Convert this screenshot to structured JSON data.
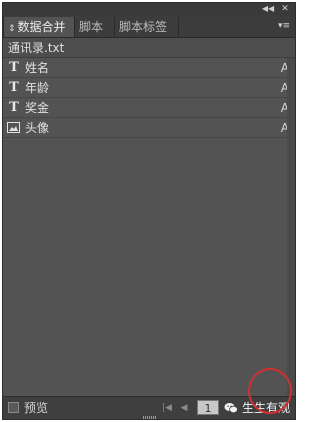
{
  "panel": {
    "titlebar": {
      "collapse_icon": "double-left-arrow",
      "close_icon": "close"
    },
    "tabs": [
      {
        "label": "数据合并",
        "active": true
      },
      {
        "label": "脚本",
        "active": false
      },
      {
        "label": "脚本标签",
        "active": false
      }
    ],
    "tab_menu_icon": "panel-menu",
    "file_name": "通讯录.txt",
    "fields": [
      {
        "icon": "text-field-icon",
        "label": "姓名",
        "align": "A"
      },
      {
        "icon": "text-field-icon",
        "label": "年龄",
        "align": "A"
      },
      {
        "icon": "text-field-icon",
        "label": "奖金",
        "align": "A"
      },
      {
        "icon": "image-field-icon",
        "label": "头像",
        "align": "A"
      }
    ],
    "bottom": {
      "preview_label": "预览",
      "preview_checked": false,
      "page_number": "1",
      "watermark_text": "生生有观"
    }
  },
  "colors": {
    "panel_bg": "#535353",
    "tabbar_bg": "#3c3c3c",
    "highlight_circle": "#d23030"
  }
}
